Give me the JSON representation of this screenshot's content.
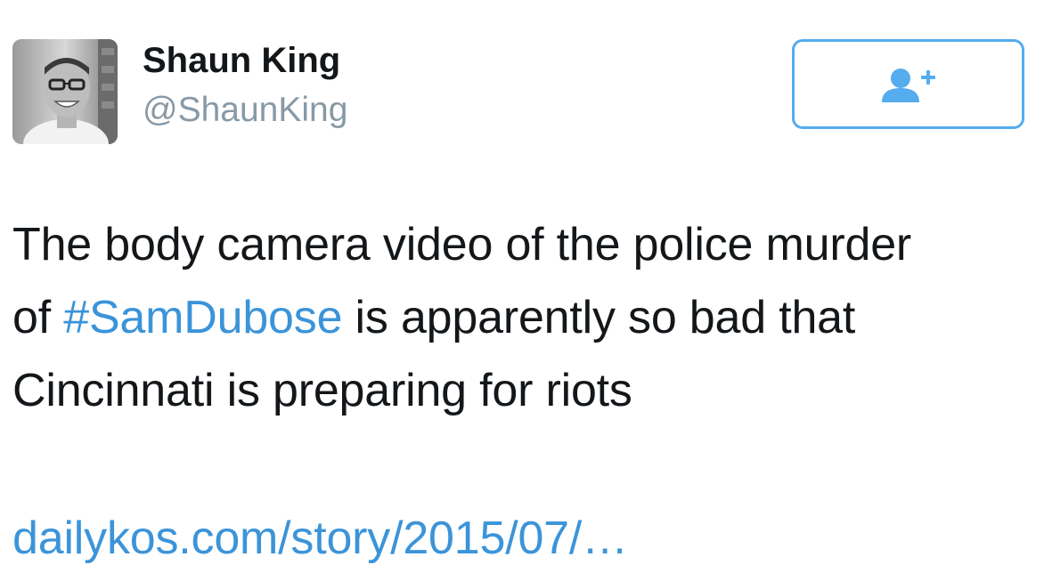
{
  "user": {
    "name": "Shaun King",
    "handle": "@ShaunKing"
  },
  "follow_button": {
    "icon": "add-user-icon",
    "color": "#55acee"
  },
  "tweet": {
    "text_line1": "The body camera video of the police murder",
    "text_of": "of ",
    "hashtag": "#SamDubose",
    "text_line2_rest": " is apparently so bad that",
    "text_line3": "Cincinnati is preparing for riots",
    "link": "dailykos.com/story/2015/07/…"
  },
  "colors": {
    "link": "#3b94d9",
    "handle": "#8899a6",
    "text": "#14171a"
  }
}
